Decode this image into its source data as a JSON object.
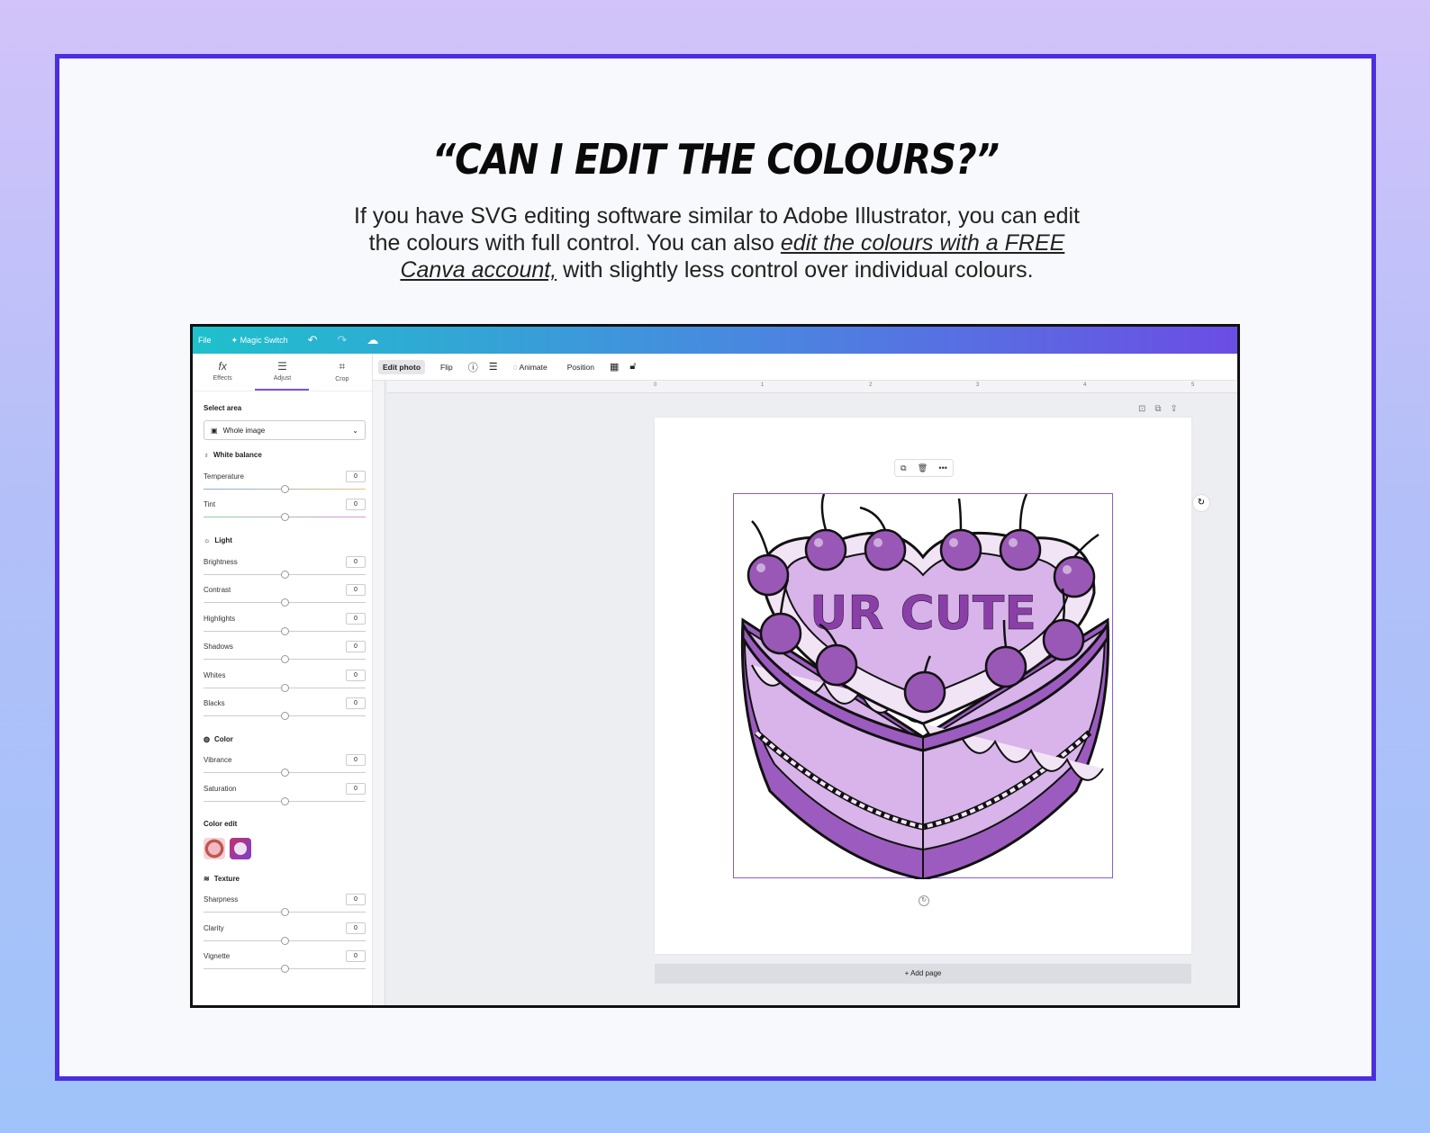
{
  "headline": "“CAN I EDIT THE COLOURS?”",
  "intro": {
    "line1": "If you have SVG editing software similar to Adobe Illustrator, you can edit",
    "line2_pre": "the colours with full control. You can also ",
    "link1": "edit the colours with a FREE",
    "link2": "Canva account,",
    "line3_post": " with slightly less control over individual colours."
  },
  "app": {
    "topbar": {
      "file": "File",
      "magic_switch": "Magic Switch",
      "magic_icon": "sparkle-icon"
    },
    "panel_tabs": [
      {
        "label": "Effects",
        "icon": "fx"
      },
      {
        "label": "Adjust",
        "icon": "☰"
      },
      {
        "label": "Crop",
        "icon": "⌗"
      }
    ],
    "select_area": {
      "title": "Select area",
      "value": "Whole image"
    },
    "sections": {
      "white_balance": "White balance",
      "light": "Light",
      "color": "Color",
      "color_edit": "Color edit",
      "texture": "Texture"
    },
    "sliders": {
      "temperature": {
        "label": "Temperature",
        "value": "0"
      },
      "tint": {
        "label": "Tint",
        "value": "0"
      },
      "brightness": {
        "label": "Brightness",
        "value": "0"
      },
      "contrast": {
        "label": "Contrast",
        "value": "0"
      },
      "highlights": {
        "label": "Highlights",
        "value": "0"
      },
      "shadows": {
        "label": "Shadows",
        "value": "0"
      },
      "whites": {
        "label": "Whites",
        "value": "0"
      },
      "blacks": {
        "label": "Blacks",
        "value": "0"
      },
      "vibrance": {
        "label": "Vibrance",
        "value": "0"
      },
      "saturation": {
        "label": "Saturation",
        "value": "0"
      },
      "sharpness": {
        "label": "Sharpness",
        "value": "0"
      },
      "clarity": {
        "label": "Clarity",
        "value": "0"
      },
      "vignette": {
        "label": "Vignette",
        "value": "0"
      }
    },
    "toolbar": {
      "edit_photo": "Edit photo",
      "flip": "Flip",
      "animate": "Animate",
      "position": "Position"
    },
    "ruler": [
      "0",
      "1",
      "2",
      "3",
      "4",
      "5"
    ],
    "cake_text": "UR CUTE",
    "add_page": "+ Add page"
  },
  "colors": {
    "frame": "#4b2ee0",
    "cake_light": "#d8b4ea",
    "cake_dark": "#9c5cbf",
    "cherry": "#9a58b6"
  }
}
